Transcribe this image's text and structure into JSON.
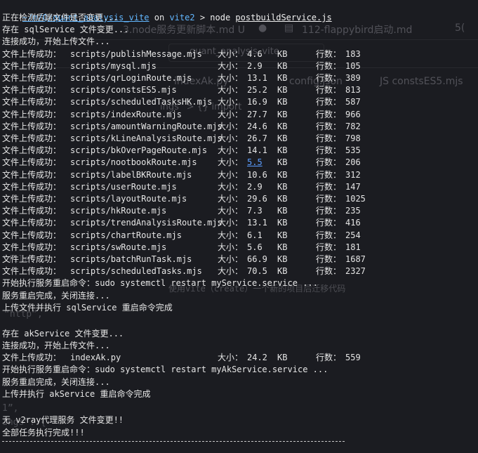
{
  "prompt": {
    "path": "~/m/Q/quant_analysis_vite",
    "on": "on",
    "branch": "vite2",
    "arrow": ">",
    "command": "node",
    "arg": "postbuildService.js"
  },
  "background_ghost": {
    "tabs": [
      "3.node服务更新脚本.md U",
      "112-flappybird启动.md",
      "5("
    ],
    "breadcrumb": "quant_analysis_vite",
    "editor_tabs": [
      "indexAk.py",
      "config.json",
      "JS  constsES5.mjs"
    ],
    "settings_path": "ings” > {} import",
    "code_fragments": [
      "“http”,",
      "ings”: {",
      "“file”",
      "1”,",
      "使用vite（create）一个新的项目后迁移代码"
    ]
  },
  "lines": [
    "正在检测后端文件是否变更...",
    "存在 sqlService 文件变更...",
    "连接成功，开始上传文件..."
  ],
  "upload_prefix": "文件上传成功：",
  "size_label": "大小：",
  "size_unit": "KB",
  "rows_label": "行数：",
  "uploads": [
    {
      "file": "scripts/publishMessage.mjs",
      "size": "4.6",
      "rows": "183"
    },
    {
      "file": "scripts/mysql.mjs",
      "size": "2.9",
      "rows": "105"
    },
    {
      "file": "scripts/qrLoginRoute.mjs",
      "size": "13.1",
      "rows": "389"
    },
    {
      "file": "scripts/constsES5.mjs",
      "size": "25.2",
      "rows": "813"
    },
    {
      "file": "scripts/scheduledTasksHK.mjs",
      "size": "16.9",
      "rows": "587"
    },
    {
      "file": "scripts/indexRoute.mjs",
      "size": "27.7",
      "rows": "966"
    },
    {
      "file": "scripts/amountWarningRoute.mjs",
      "size": "24.6",
      "rows": "782"
    },
    {
      "file": "scripts/kLineAnalysisRoute.mjs",
      "size": "26.7",
      "rows": "798"
    },
    {
      "file": "scripts/bkOverPageRoute.mjs",
      "size": "14.1",
      "rows": "535"
    },
    {
      "file": "scripts/nootbookRoute.mjs",
      "size": "5.5",
      "rows": "206",
      "link": true
    },
    {
      "file": "scripts/labelBKRoute.mjs",
      "size": "10.6",
      "rows": "312"
    },
    {
      "file": "scripts/userRoute.mjs",
      "size": "2.9",
      "rows": "147"
    },
    {
      "file": "scripts/layoutRoute.mjs",
      "size": "29.6",
      "rows": "1025"
    },
    {
      "file": "scripts/hkRoute.mjs",
      "size": "7.3",
      "rows": "235"
    },
    {
      "file": "scripts/trendAnalysisRoute.mjs",
      "size": "13.1",
      "rows": "416"
    },
    {
      "file": "scripts/chartRoute.mjs",
      "size": "6.1",
      "rows": "254"
    },
    {
      "file": "scripts/swRoute.mjs",
      "size": "5.6",
      "rows": "181"
    },
    {
      "file": "scripts/batchRunTask.mjs",
      "size": "66.9",
      "rows": "1687"
    },
    {
      "file": "scripts/scheduledTasks.mjs",
      "size": "70.5",
      "rows": "2327"
    }
  ],
  "sql_after": [
    "开始执行服务重启命令：sudo systemctl restart myService.service ...",
    "服务重启完成，关闭连接...",
    "上传文件并执行 sqlService 重启命令完成"
  ],
  "ak_before": [
    "存在 akService 文件变更...",
    "连接成功，开始上传文件..."
  ],
  "ak_upload": {
    "file": "indexAk.py",
    "size": "24.2",
    "rows": "559"
  },
  "ak_after": [
    "开始执行服务重启命令：sudo systemctl restart myAkService.service ...",
    "服务重启完成，关闭连接...",
    "上传并执行 akService 重启命令完成"
  ],
  "v2ray_line": "无 v2ray代理服务 文件变更!!",
  "done_line": "全部任务执行完成!!!"
}
